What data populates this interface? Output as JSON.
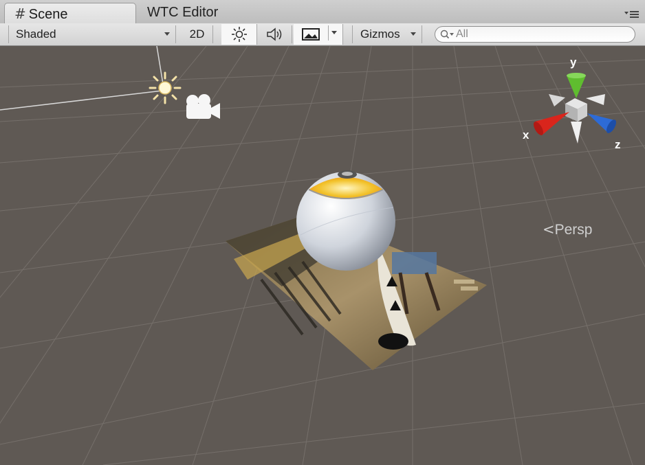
{
  "tabs": [
    {
      "label": "Scene",
      "icon": "grid-hash-icon",
      "active": true
    },
    {
      "label": "WTC Editor",
      "active": false
    }
  ],
  "toolbar": {
    "render_mode": "Shaded",
    "mode_2d": "2D",
    "lighting_icon": "sun-icon",
    "audio_icon": "speaker-icon",
    "effects_icon": "image-icon",
    "gizmos_label": "Gizmos",
    "search_placeholder": "All"
  },
  "gizmo": {
    "x_label": "x",
    "y_label": "y",
    "z_label": "z",
    "x_color": "#d9251c",
    "y_color": "#5fbd2f",
    "z_color": "#2d6bd6",
    "projection_label": "Persp"
  },
  "scene_objects": {
    "light_icon": "directional-light-icon",
    "camera_icon": "camera-icon",
    "sphere_icon": "sphere-object",
    "photo_plane": "textured-plane"
  }
}
